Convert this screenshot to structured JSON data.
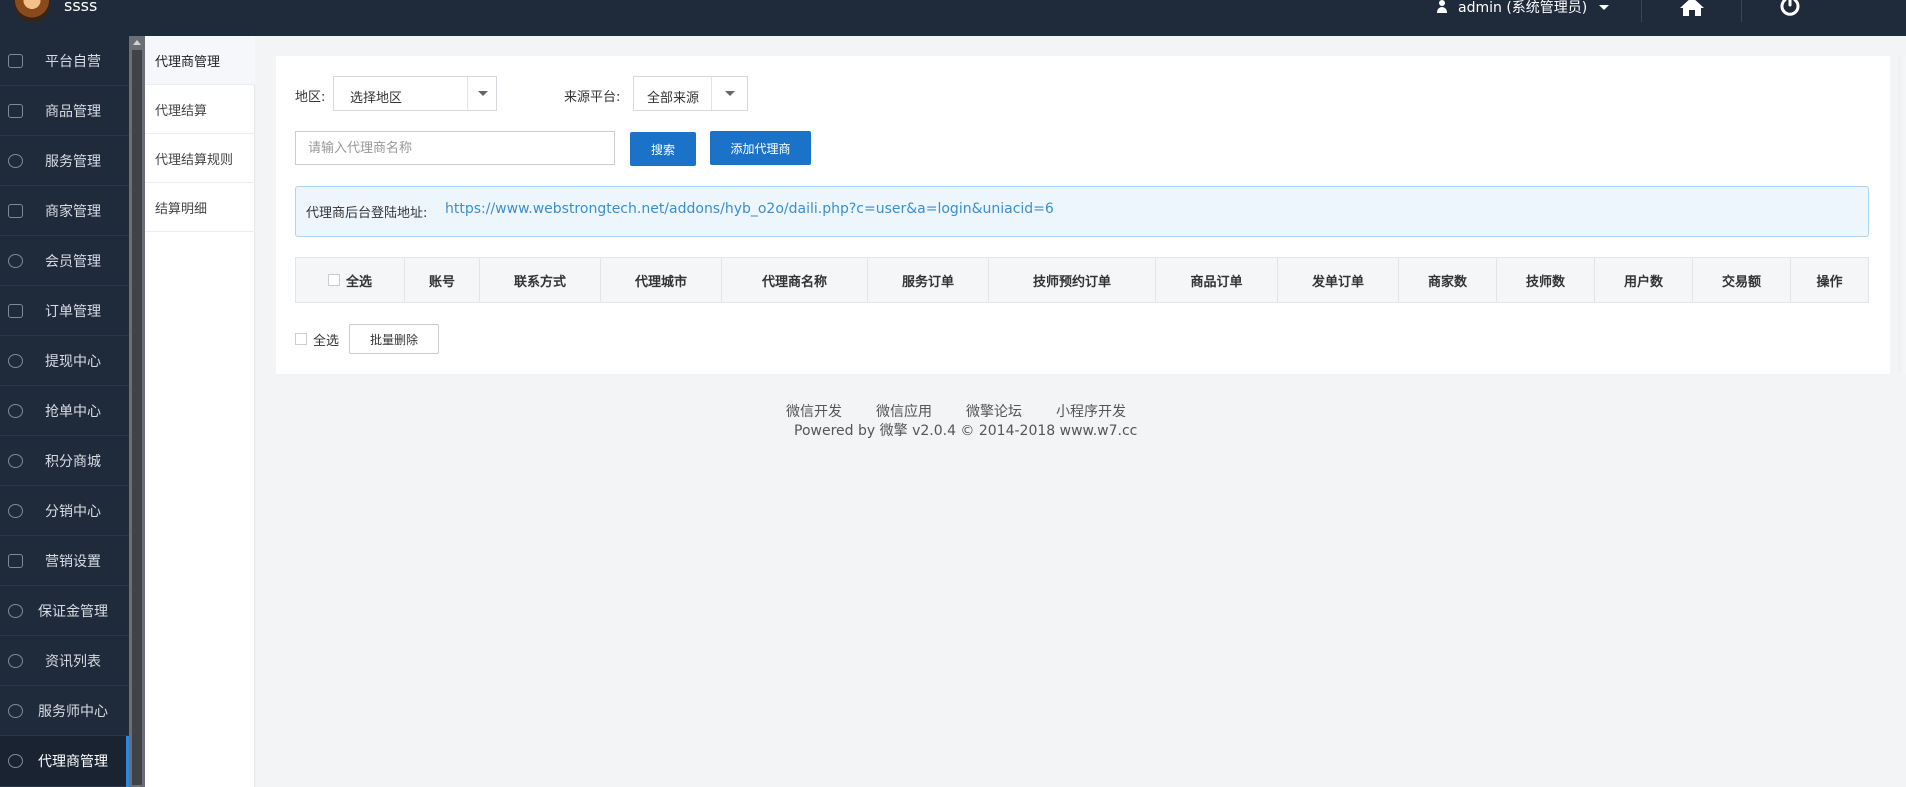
{
  "header": {
    "brand": "ssss",
    "user": "admin (系统管理员)"
  },
  "sidebar": {
    "items": [
      {
        "label": "平台自营"
      },
      {
        "label": "商品管理"
      },
      {
        "label": "服务管理"
      },
      {
        "label": "商家管理"
      },
      {
        "label": "会员管理"
      },
      {
        "label": "订单管理"
      },
      {
        "label": "提现中心"
      },
      {
        "label": "抢单中心"
      },
      {
        "label": "积分商城"
      },
      {
        "label": "分销中心"
      },
      {
        "label": "营销设置"
      },
      {
        "label": "保证金管理"
      },
      {
        "label": "资讯列表"
      },
      {
        "label": "服务师中心"
      },
      {
        "label": "代理商管理"
      }
    ],
    "active": "代理商管理"
  },
  "subnav": {
    "items": [
      {
        "label": "代理商管理"
      },
      {
        "label": "代理结算"
      },
      {
        "label": "代理结算规则"
      },
      {
        "label": "结算明细"
      }
    ],
    "active": "代理商管理"
  },
  "filters": {
    "region_label": "地区:",
    "region_value": "选择地区",
    "source_label": "来源平台:",
    "source_value": "全部来源",
    "search_placeholder": "请输入代理商名称",
    "search_button": "搜索",
    "add_button": "添加代理商"
  },
  "notice": {
    "label": "代理商后台登陆地址:",
    "url": "https://www.webstrongtech.net/addons/hyb_o2o/daili.php?c=user&a=login&uniacid=6"
  },
  "table": {
    "select_all": "全选",
    "columns": [
      "账号",
      "联系方式",
      "代理城市",
      "代理商名称",
      "服务订单",
      "技师预约订单",
      "商品订单",
      "发单订单",
      "商家数",
      "技师数",
      "用户数",
      "交易额",
      "操作"
    ],
    "rows": []
  },
  "bulk": {
    "select_all": "全选",
    "delete_button": "批量删除"
  },
  "footer": {
    "links": [
      "微信开发",
      "微信应用",
      "微擎论坛",
      "小程序开发"
    ],
    "powered_prefix": "Powered by",
    "brand": "微擎",
    "powered_suffix": "v2.0.4 © 2014-2018 www.w7.cc"
  }
}
